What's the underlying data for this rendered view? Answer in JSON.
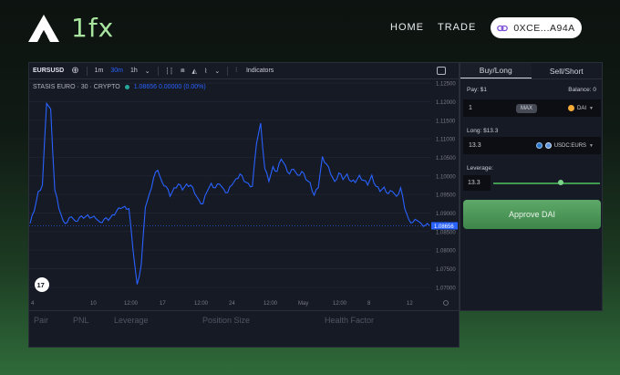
{
  "header": {
    "logo_text": "1fx",
    "nav": {
      "home": "HOME",
      "trade": "TRADE"
    },
    "wallet_address": "0XCE...A94A"
  },
  "chart": {
    "toolbar": {
      "symbol": "EURSUSD",
      "timeframes": [
        "1m",
        "30m",
        "1h"
      ],
      "active_timeframe": "30m",
      "indicators_label": "Indicators"
    },
    "legend": {
      "title": "STASIS EURO · 30 · CRYPTO",
      "values": "1.08656  0.00000 (0.00%)"
    },
    "price_tag": "1.08656",
    "y_ticks": [
      "1.12500",
      "1.12000",
      "1.11500",
      "1.11000",
      "1.10500",
      "1.10000",
      "1.09500",
      "1.09000",
      "1.08500",
      "1.08000",
      "1.07500",
      "1.07000"
    ],
    "x_ticks": [
      "4",
      "10",
      "12:00",
      "17",
      "12:00",
      "24",
      "12:00",
      "May",
      "12:00",
      "8",
      "12"
    ],
    "line_color": "#2962ff"
  },
  "chart_data": {
    "type": "line",
    "title": "STASIS EURO · 30 · CRYPTO",
    "xlabel": "",
    "ylabel": "",
    "ylim": [
      1.0675,
      1.126
    ],
    "x_ticks": [
      "4",
      "10",
      "12:00",
      "17",
      "12:00",
      "24",
      "12:00",
      "May",
      "12:00",
      "8",
      "12"
    ],
    "series": [
      {
        "name": "EURSUSD",
        "values": [
          1.0872,
          1.0905,
          1.0958,
          1.0975,
          1.1195,
          1.118,
          1.0962,
          1.0912,
          1.088,
          1.0874,
          1.089,
          1.0878,
          1.0888,
          1.0886,
          1.0895,
          1.0888,
          1.0885,
          1.0875,
          1.0884,
          1.088,
          1.0895,
          1.0905,
          1.0912,
          1.0918,
          1.0912,
          1.08,
          1.0708,
          1.076,
          1.0915,
          1.0952,
          1.0995,
          1.1015,
          1.0985,
          1.0972,
          1.0945,
          1.0968,
          1.0978,
          1.0962,
          1.0978,
          1.0975,
          1.0952,
          1.0935,
          1.0925,
          1.0958,
          1.098,
          1.0968,
          1.0978,
          1.0965,
          1.0955,
          1.0975,
          1.0992,
          1.1005,
          1.0985,
          1.098,
          1.0972,
          1.1088,
          1.1142,
          1.102,
          1.0985,
          1.1025,
          1.1012,
          1.1045,
          1.1028,
          1.1005,
          1.1018,
          1.1002,
          1.1012,
          1.099,
          1.0982,
          1.0948,
          1.0968,
          1.1052,
          1.1032,
          1.1005,
          1.0985,
          1.1008,
          1.099,
          1.1005,
          1.0985,
          1.0982,
          1.1002,
          1.0988,
          1.0975,
          1.1002,
          1.0972,
          1.0958,
          1.097,
          1.0952,
          1.0958,
          1.0945,
          1.0968,
          1.0912,
          1.0882,
          1.0875,
          1.088,
          1.0872,
          1.0867,
          1.0866
        ]
      }
    ],
    "last_value": 1.08656,
    "grid": true,
    "legend": "top-left"
  },
  "positions": {
    "columns": [
      "Pair",
      "PNL",
      "Leverage",
      "Position Size",
      "Health Factor"
    ]
  },
  "trade": {
    "tabs": [
      "Buy/Long",
      "Sell/Short"
    ],
    "active_tab": "Buy/Long",
    "pay_label": "Pay: $1",
    "balance_label": "Balance: 0",
    "pay_amount": "1",
    "max_label": "MAX",
    "pay_token": "DAI",
    "long_label": "Long: $13.3",
    "long_amount": "13.3",
    "long_token": "USDC:EURS",
    "leverage_label": "Leverage:",
    "leverage_value": "13.3",
    "leverage_slider_fraction": 0.84,
    "approve_label": "Approve DAI",
    "accent_color": "#4a9a58"
  }
}
